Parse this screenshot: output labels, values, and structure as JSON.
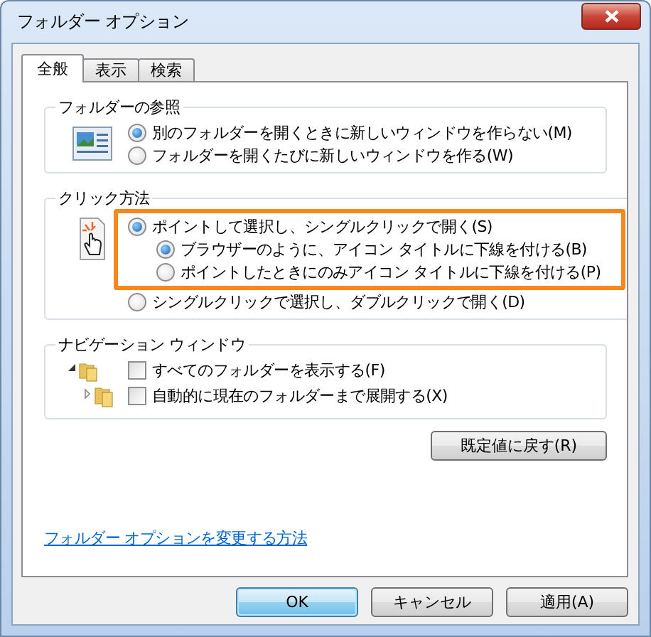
{
  "window": {
    "title": "フォルダー オプション"
  },
  "tabs": [
    {
      "label": "全般",
      "selected": true
    },
    {
      "label": "表示",
      "selected": false
    },
    {
      "label": "検索",
      "selected": false
    }
  ],
  "groups": [
    {
      "kind": "radio",
      "title": "フォルダーの参照",
      "options": [
        {
          "label": "別のフォルダーを開くときに新しいウィンドウを作らない(M)",
          "selected": true
        },
        {
          "label": "フォルダーを開くたびに新しいウィンドウを作る(W)",
          "selected": false
        }
      ]
    },
    {
      "kind": "radio",
      "title": "クリック方法",
      "options": [
        {
          "label": "ポイントして選択し、シングルクリックで開く(S)",
          "selected": true,
          "highlighted": true,
          "children": [
            {
              "label": "ブラウザーのように、アイコン タイトルに下線を付ける(B)",
              "selected": true
            },
            {
              "label": "ポイントしたときにのみアイコン タイトルに下線を付ける(P)",
              "selected": false
            }
          ]
        },
        {
          "label": "シングルクリックで選択し、ダブルクリックで開く(D)",
          "selected": false,
          "highlighted": false
        }
      ]
    },
    {
      "kind": "checkbox",
      "title": "ナビゲーション ウィンドウ",
      "options": [
        {
          "label": "すべてのフォルダーを表示する(F)",
          "checked": false
        },
        {
          "label": "自動的に現在のフォルダーまで展開する(X)",
          "checked": false
        }
      ]
    }
  ],
  "restore_button": "既定値に戻す(R)",
  "help_link": "フォルダー オプションを変更する方法",
  "buttons": [
    {
      "label": "OK",
      "default": true
    },
    {
      "label": "キャンセル",
      "default": false
    },
    {
      "label": "適用(A)",
      "default": false
    }
  ]
}
